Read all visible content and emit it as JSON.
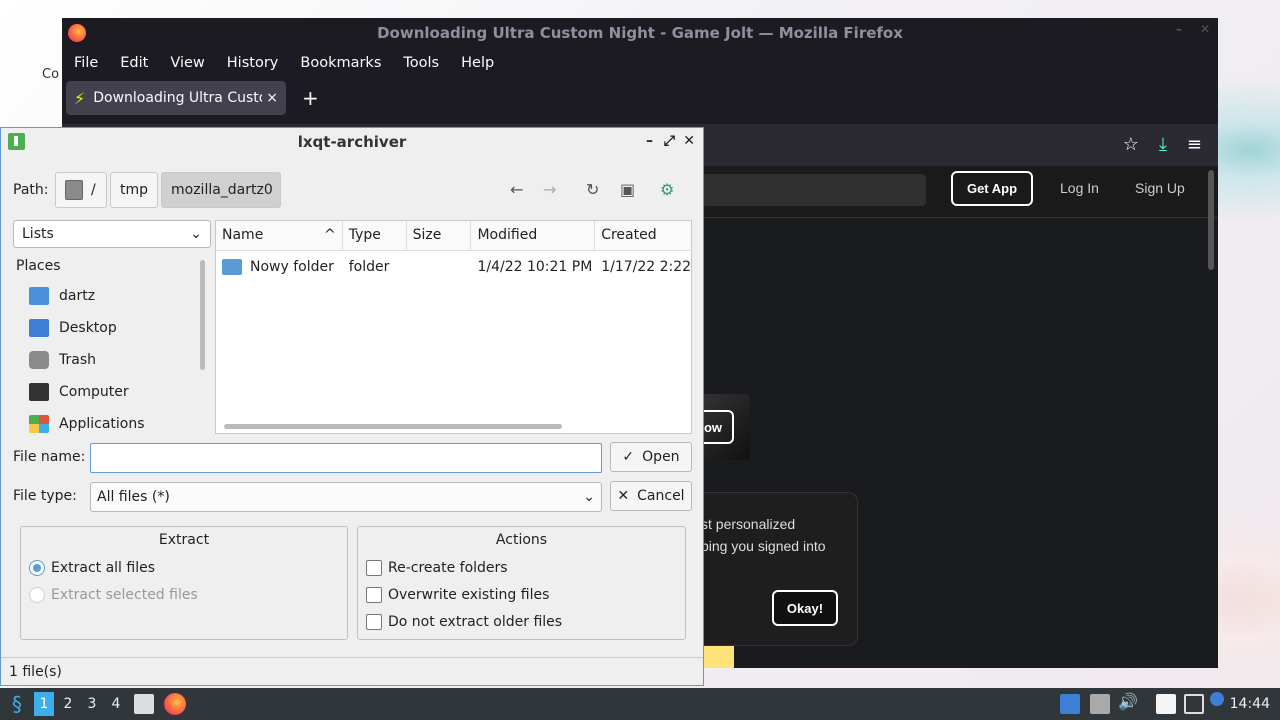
{
  "desktop": {
    "label": "Co"
  },
  "firefox": {
    "window_title": "Downloading Ultra Custom Night - Game Jolt — Mozilla Firefox",
    "menu": [
      "File",
      "Edit",
      "View",
      "History",
      "Bookmarks",
      "Tools",
      "Help"
    ],
    "tab_title": "Downloading Ultra Custo",
    "tab_close": "×",
    "new_tab": "+",
    "page": {
      "get_app": "Get App",
      "log_in": "Log In",
      "sign_up": "Sign Up",
      "partial_button": "ow",
      "cookie_line1": "st personalized",
      "cookie_line2": "ping you signed into",
      "okay": "Okay!"
    }
  },
  "dialog": {
    "title": "lxqt-archiver",
    "path_label": "Path:",
    "crumbs": [
      "/",
      "tmp",
      "mozilla_dartz0"
    ],
    "places_combo": "Lists",
    "places_header": "Places",
    "places": [
      {
        "label": "dartz",
        "icon": "home-folder-icon",
        "color": "#4a90d9"
      },
      {
        "label": "Desktop",
        "icon": "desktop-icon",
        "color": "#3d7fd4"
      },
      {
        "label": "Trash",
        "icon": "trash-icon",
        "color": "#8a8a8a"
      },
      {
        "label": "Computer",
        "icon": "computer-icon",
        "color": "#333333"
      },
      {
        "label": "Applications",
        "icon": "applications-icon",
        "color": "#e0543c"
      }
    ],
    "columns": [
      "Name",
      "Type",
      "Size",
      "Modified",
      "Created"
    ],
    "rows": [
      {
        "name": "Nowy folder",
        "type": "folder",
        "size": "",
        "modified": "1/4/22 10:21 PM",
        "created": "1/17/22 2:22"
      }
    ],
    "file_name_label": "File name:",
    "file_name_value": "",
    "file_type_label": "File type:",
    "file_type_value": "All files (*)",
    "open_button": "Open",
    "cancel_button": "Cancel",
    "extract_group": "Extract",
    "extract_all": "Extract all files",
    "extract_selected": "Extract selected files",
    "actions_group": "Actions",
    "recreate_folders": "Re-create folders",
    "overwrite_existing": "Overwrite existing files",
    "no_older": "Do not extract older files",
    "status": "1 file(s)"
  },
  "taskbar": {
    "workspaces": [
      "1",
      "2",
      "3",
      "4"
    ],
    "clock": "14:44"
  }
}
